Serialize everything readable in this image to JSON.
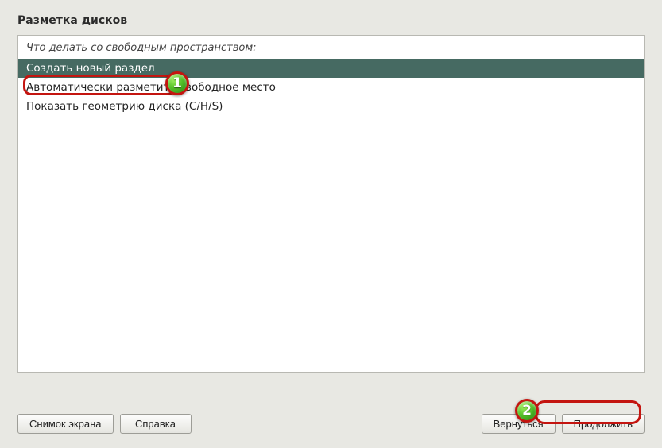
{
  "title": "Разметка дисков",
  "prompt": "Что делать со свободным пространством:",
  "options": [
    {
      "label": "Создать новый раздел",
      "selected": true
    },
    {
      "label": "Автоматически разметить свободное место",
      "selected": false
    },
    {
      "label": "Показать геометрию диска (C/H/S)",
      "selected": false
    }
  ],
  "buttons": {
    "screenshot": "Снимок экрана",
    "help": "Справка",
    "back": "Вернуться",
    "continue": "Продолжить"
  },
  "callouts": {
    "one": "1",
    "two": "2"
  }
}
